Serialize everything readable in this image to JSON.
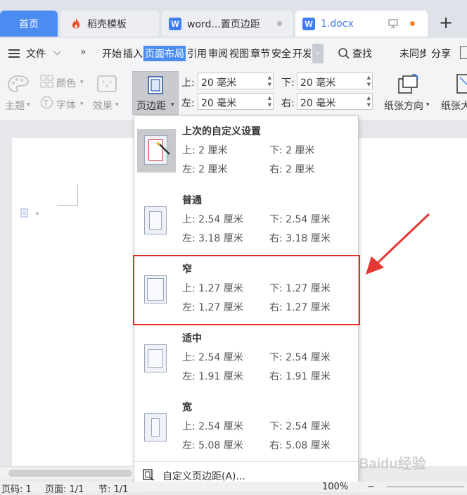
{
  "tabs": [
    {
      "label": "首页"
    },
    {
      "label": "稻壳模板"
    },
    {
      "label": "word...置页边距"
    },
    {
      "label": "1.docx"
    }
  ],
  "tab_new_symbol": "+",
  "menu": {
    "file_label": "文件",
    "more_symbol": "»",
    "items": [
      "开始",
      "插入",
      "页面布局",
      "引用",
      "审阅",
      "视图",
      "章节",
      "安全",
      "开发"
    ],
    "search_label": "查找",
    "unsync_label": "未同步",
    "share_label": "分享"
  },
  "toolbar": {
    "color_label": "颜色",
    "theme_label": "主题",
    "font_label": "字体",
    "effect_label": "效果",
    "margins_label": "页边距",
    "top_label": "上:",
    "top_value": "20 毫米",
    "bottom_label": "下:",
    "bottom_value": "20 毫米",
    "left_label": "左:",
    "left_value": "20 毫米",
    "right_label": "右:",
    "right_value": "20 毫米",
    "orientation_label": "纸张方向",
    "size_label": "纸张大"
  },
  "dropdown": {
    "presets": [
      {
        "name": "上次的自定义设置",
        "top": "上: 2 厘米",
        "bottom": "下: 2 厘米",
        "left": "左: 2 厘米",
        "right": "右: 2 厘米"
      },
      {
        "name": "普通",
        "top": "上: 2.54 厘米",
        "bottom": "下: 2.54 厘米",
        "left": "左: 3.18 厘米",
        "right": "右: 3.18 厘米"
      },
      {
        "name": "窄",
        "top": "上: 1.27 厘米",
        "bottom": "下: 1.27 厘米",
        "left": "左: 1.27 厘米",
        "right": "右: 1.27 厘米"
      },
      {
        "name": "适中",
        "top": "上: 2.54 厘米",
        "bottom": "下: 2.54 厘米",
        "left": "左: 1.91 厘米",
        "right": "右: 1.91 厘米"
      },
      {
        "name": "宽",
        "top": "上: 2.54 厘米",
        "bottom": "下: 2.54 厘米",
        "left": "左: 5.08 厘米",
        "right": "右: 5.08 厘米"
      }
    ],
    "custom_label": "自定义页边距(A)..."
  },
  "statusbar": {
    "page_no": "页码: 1",
    "pages": "页面: 1/1",
    "section": "节: 1/1",
    "zoom": "100%"
  },
  "watermark": "Baidu经验",
  "colors": {
    "accent": "#4a8cf0",
    "highlight_box": "#e0302b",
    "arrow": "#e53935"
  }
}
